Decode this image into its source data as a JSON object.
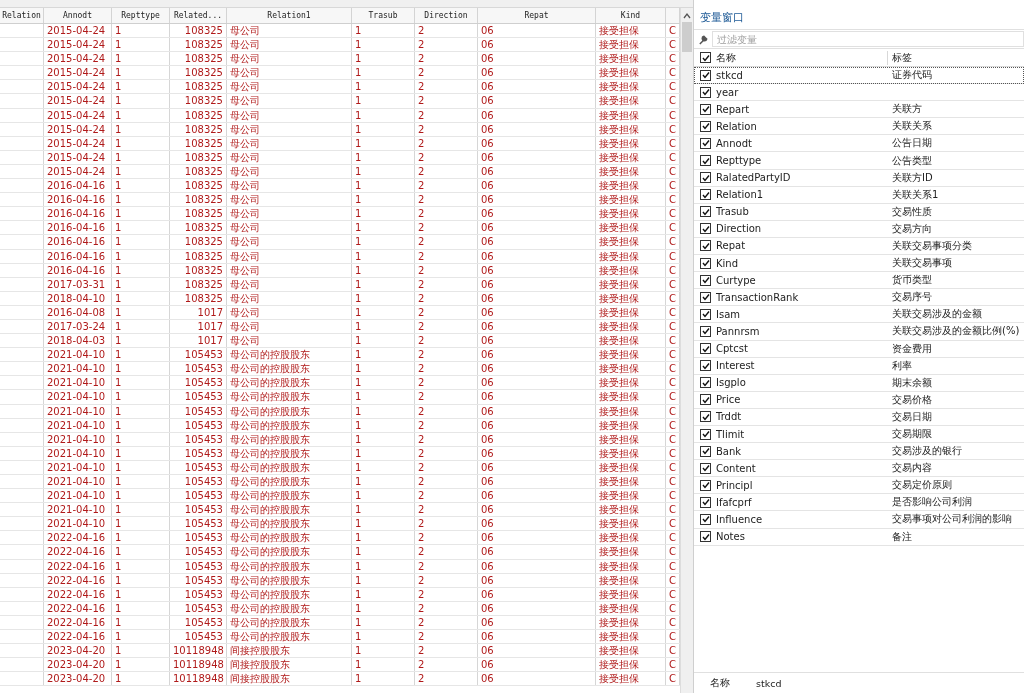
{
  "grid": {
    "columns": [
      "Relation",
      "Annodt",
      "Repttype",
      "Related...",
      "Relation1",
      "Trasub",
      "Direction",
      "Repat",
      "Kind"
    ],
    "rows": [
      [
        "",
        "2015-04-24",
        "1",
        "108325",
        "母公司",
        "1",
        "2",
        "06",
        "接受担保",
        "C"
      ],
      [
        "",
        "2015-04-24",
        "1",
        "108325",
        "母公司",
        "1",
        "2",
        "06",
        "接受担保",
        "C"
      ],
      [
        "",
        "2015-04-24",
        "1",
        "108325",
        "母公司",
        "1",
        "2",
        "06",
        "接受担保",
        "C"
      ],
      [
        "",
        "2015-04-24",
        "1",
        "108325",
        "母公司",
        "1",
        "2",
        "06",
        "接受担保",
        "C"
      ],
      [
        "",
        "2015-04-24",
        "1",
        "108325",
        "母公司",
        "1",
        "2",
        "06",
        "接受担保",
        "C"
      ],
      [
        "",
        "2015-04-24",
        "1",
        "108325",
        "母公司",
        "1",
        "2",
        "06",
        "接受担保",
        "C"
      ],
      [
        "",
        "2015-04-24",
        "1",
        "108325",
        "母公司",
        "1",
        "2",
        "06",
        "接受担保",
        "C"
      ],
      [
        "",
        "2015-04-24",
        "1",
        "108325",
        "母公司",
        "1",
        "2",
        "06",
        "接受担保",
        "C"
      ],
      [
        "",
        "2015-04-24",
        "1",
        "108325",
        "母公司",
        "1",
        "2",
        "06",
        "接受担保",
        "C"
      ],
      [
        "",
        "2015-04-24",
        "1",
        "108325",
        "母公司",
        "1",
        "2",
        "06",
        "接受担保",
        "C"
      ],
      [
        "",
        "2015-04-24",
        "1",
        "108325",
        "母公司",
        "1",
        "2",
        "06",
        "接受担保",
        "C"
      ],
      [
        "",
        "2016-04-16",
        "1",
        "108325",
        "母公司",
        "1",
        "2",
        "06",
        "接受担保",
        "C"
      ],
      [
        "",
        "2016-04-16",
        "1",
        "108325",
        "母公司",
        "1",
        "2",
        "06",
        "接受担保",
        "C"
      ],
      [
        "",
        "2016-04-16",
        "1",
        "108325",
        "母公司",
        "1",
        "2",
        "06",
        "接受担保",
        "C"
      ],
      [
        "",
        "2016-04-16",
        "1",
        "108325",
        "母公司",
        "1",
        "2",
        "06",
        "接受担保",
        "C"
      ],
      [
        "",
        "2016-04-16",
        "1",
        "108325",
        "母公司",
        "1",
        "2",
        "06",
        "接受担保",
        "C"
      ],
      [
        "",
        "2016-04-16",
        "1",
        "108325",
        "母公司",
        "1",
        "2",
        "06",
        "接受担保",
        "C"
      ],
      [
        "",
        "2016-04-16",
        "1",
        "108325",
        "母公司",
        "1",
        "2",
        "06",
        "接受担保",
        "C"
      ],
      [
        "",
        "2017-03-31",
        "1",
        "108325",
        "母公司",
        "1",
        "2",
        "06",
        "接受担保",
        "C"
      ],
      [
        "",
        "2018-04-10",
        "1",
        "108325",
        "母公司",
        "1",
        "2",
        "06",
        "接受担保",
        "C"
      ],
      [
        "",
        "2016-04-08",
        "1",
        "1017",
        "母公司",
        "1",
        "2",
        "06",
        "接受担保",
        "C"
      ],
      [
        "",
        "2017-03-24",
        "1",
        "1017",
        "母公司",
        "1",
        "2",
        "06",
        "接受担保",
        "C"
      ],
      [
        "",
        "2018-04-03",
        "1",
        "1017",
        "母公司",
        "1",
        "2",
        "06",
        "接受担保",
        "C"
      ],
      [
        "",
        "2021-04-10",
        "1",
        "105453",
        "母公司的控股股东",
        "1",
        "2",
        "06",
        "接受担保",
        "C"
      ],
      [
        "",
        "2021-04-10",
        "1",
        "105453",
        "母公司的控股股东",
        "1",
        "2",
        "06",
        "接受担保",
        "C"
      ],
      [
        "",
        "2021-04-10",
        "1",
        "105453",
        "母公司的控股股东",
        "1",
        "2",
        "06",
        "接受担保",
        "C"
      ],
      [
        "",
        "2021-04-10",
        "1",
        "105453",
        "母公司的控股股东",
        "1",
        "2",
        "06",
        "接受担保",
        "C"
      ],
      [
        "",
        "2021-04-10",
        "1",
        "105453",
        "母公司的控股股东",
        "1",
        "2",
        "06",
        "接受担保",
        "C"
      ],
      [
        "",
        "2021-04-10",
        "1",
        "105453",
        "母公司的控股股东",
        "1",
        "2",
        "06",
        "接受担保",
        "C"
      ],
      [
        "",
        "2021-04-10",
        "1",
        "105453",
        "母公司的控股股东",
        "1",
        "2",
        "06",
        "接受担保",
        "C"
      ],
      [
        "",
        "2021-04-10",
        "1",
        "105453",
        "母公司的控股股东",
        "1",
        "2",
        "06",
        "接受担保",
        "C"
      ],
      [
        "",
        "2021-04-10",
        "1",
        "105453",
        "母公司的控股股东",
        "1",
        "2",
        "06",
        "接受担保",
        "C"
      ],
      [
        "",
        "2021-04-10",
        "1",
        "105453",
        "母公司的控股股东",
        "1",
        "2",
        "06",
        "接受担保",
        "C"
      ],
      [
        "",
        "2021-04-10",
        "1",
        "105453",
        "母公司的控股股东",
        "1",
        "2",
        "06",
        "接受担保",
        "C"
      ],
      [
        "",
        "2021-04-10",
        "1",
        "105453",
        "母公司的控股股东",
        "1",
        "2",
        "06",
        "接受担保",
        "C"
      ],
      [
        "",
        "2021-04-10",
        "1",
        "105453",
        "母公司的控股股东",
        "1",
        "2",
        "06",
        "接受担保",
        "C"
      ],
      [
        "",
        "2022-04-16",
        "1",
        "105453",
        "母公司的控股股东",
        "1",
        "2",
        "06",
        "接受担保",
        "C"
      ],
      [
        "",
        "2022-04-16",
        "1",
        "105453",
        "母公司的控股股东",
        "1",
        "2",
        "06",
        "接受担保",
        "C"
      ],
      [
        "",
        "2022-04-16",
        "1",
        "105453",
        "母公司的控股股东",
        "1",
        "2",
        "06",
        "接受担保",
        "C"
      ],
      [
        "",
        "2022-04-16",
        "1",
        "105453",
        "母公司的控股股东",
        "1",
        "2",
        "06",
        "接受担保",
        "C"
      ],
      [
        "",
        "2022-04-16",
        "1",
        "105453",
        "母公司的控股股东",
        "1",
        "2",
        "06",
        "接受担保",
        "C"
      ],
      [
        "",
        "2022-04-16",
        "1",
        "105453",
        "母公司的控股股东",
        "1",
        "2",
        "06",
        "接受担保",
        "C"
      ],
      [
        "",
        "2022-04-16",
        "1",
        "105453",
        "母公司的控股股东",
        "1",
        "2",
        "06",
        "接受担保",
        "C"
      ],
      [
        "",
        "2022-04-16",
        "1",
        "105453",
        "母公司的控股股东",
        "1",
        "2",
        "06",
        "接受担保",
        "C"
      ],
      [
        "",
        "2023-04-20",
        "1",
        "10118948",
        "间接控股股东",
        "1",
        "2",
        "06",
        "接受担保",
        "C"
      ],
      [
        "",
        "2023-04-20",
        "1",
        "10118948",
        "间接控股股东",
        "1",
        "2",
        "06",
        "接受担保",
        "C"
      ],
      [
        "",
        "2023-04-20",
        "1",
        "10118948",
        "间接控股股东",
        "1",
        "2",
        "06",
        "接受担保",
        "C"
      ]
    ]
  },
  "variables_window": {
    "title": "变量窗口",
    "filter": {
      "placeholder": "过滤变量"
    },
    "header": {
      "checked": true,
      "name": "名称",
      "label": "标签"
    },
    "variables": [
      {
        "name": "stkcd",
        "label": "证券代码",
        "checked": true,
        "selected": true
      },
      {
        "name": "year",
        "checked": true,
        "selected": false
      },
      {
        "name": "Repart",
        "label": "关联方",
        "checked": true,
        "selected": false
      },
      {
        "name": "Relation",
        "label": "关联关系",
        "checked": true,
        "selected": false
      },
      {
        "name": "Annodt",
        "label": "公告日期",
        "checked": true,
        "selected": false
      },
      {
        "name": "Repttype",
        "label": "公告类型",
        "checked": true,
        "selected": false
      },
      {
        "name": "RalatedPartyID",
        "label": "关联方ID",
        "checked": true,
        "selected": false
      },
      {
        "name": "Relation1",
        "label": "关联关系1",
        "checked": true,
        "selected": false
      },
      {
        "name": "Trasub",
        "label": "交易性质",
        "checked": true,
        "selected": false
      },
      {
        "name": "Direction",
        "label": "交易方向",
        "checked": true,
        "selected": false
      },
      {
        "name": "Repat",
        "label": "关联交易事项分类",
        "checked": true,
        "selected": false
      },
      {
        "name": "Kind",
        "label": "关联交易事项",
        "checked": true,
        "selected": false
      },
      {
        "name": "Curtype",
        "label": "货币类型",
        "checked": true,
        "selected": false
      },
      {
        "name": "TransactionRank",
        "label": "交易序号",
        "checked": true,
        "selected": false
      },
      {
        "name": "Isam",
        "label": "关联交易涉及的金额",
        "checked": true,
        "selected": false
      },
      {
        "name": "Pannrsm",
        "label": "关联交易涉及的金额比例(%)",
        "checked": true,
        "selected": false
      },
      {
        "name": "Cptcst",
        "label": "资金费用",
        "checked": true,
        "selected": false
      },
      {
        "name": "Interest",
        "label": "利率",
        "checked": true,
        "selected": false
      },
      {
        "name": "Isgplo",
        "label": "期末余额",
        "checked": true,
        "selected": false
      },
      {
        "name": "Price",
        "label": "交易价格",
        "checked": true,
        "selected": false
      },
      {
        "name": "Trddt",
        "label": "交易日期",
        "checked": true,
        "selected": false
      },
      {
        "name": "Tlimit",
        "label": "交易期限",
        "checked": true,
        "selected": false
      },
      {
        "name": "Bank",
        "label": "交易涉及的银行",
        "checked": true,
        "selected": false
      },
      {
        "name": "Content",
        "label": "交易内容",
        "checked": true,
        "selected": false
      },
      {
        "name": "Principl",
        "label": "交易定价原则",
        "checked": true,
        "selected": false
      },
      {
        "name": "Ifafcprf",
        "label": "是否影响公司利润",
        "checked": true,
        "selected": false
      },
      {
        "name": "Influence",
        "label": "交易事项对公司利润的影响",
        "checked": true,
        "selected": false
      },
      {
        "name": "Notes",
        "label": "备注",
        "checked": true,
        "selected": false
      }
    ]
  },
  "properties": {
    "key": "名称",
    "value": "stkcd"
  }
}
